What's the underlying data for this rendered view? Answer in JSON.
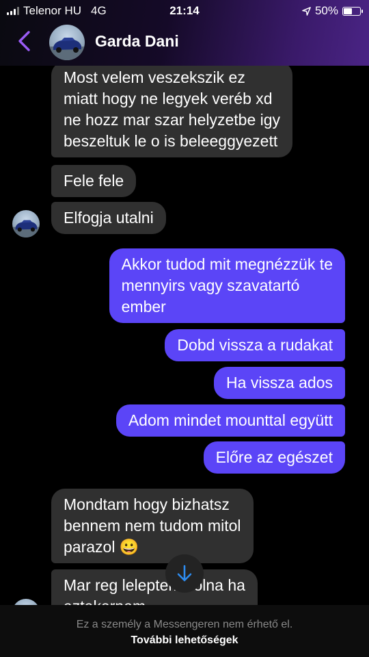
{
  "status_bar": {
    "carrier": "Telenor HU",
    "network": "4G",
    "time": "21:14",
    "battery": "50%",
    "battery_level": 0.5
  },
  "header": {
    "contact_name": "Garda Dani",
    "avatar_icon": "car-photo",
    "accent_color": "#9b5cf6"
  },
  "messages": [
    {
      "side": "in",
      "text": "Most velem veszekszik ez\nmiatt hogy ne legyek veréb xd\nne hozz mar szar helyzetbe igy\nbeszeltuk le o is beleeggyezett"
    },
    {
      "side": "in",
      "text": "Fele fele"
    },
    {
      "side": "in",
      "text": "Elfogja utalni"
    },
    {
      "side": "out",
      "text": "Akkor tudod mit megnézzük te\nmennyirs vagy szavatartó\nember"
    },
    {
      "side": "out",
      "text": "Dobd vissza a rudakat"
    },
    {
      "side": "out",
      "text": "Ha vissza ados"
    },
    {
      "side": "out",
      "text": "Adom mindet mounttal együtt"
    },
    {
      "side": "out",
      "text": "Előre az egészet"
    },
    {
      "side": "in",
      "text": "Mondtam hogy bizhatsz\nbennem nem tudom mitol\nparazol 😀"
    },
    {
      "side": "in",
      "text": "Mar reg leleptem volna ha\naztakarnam"
    }
  ],
  "colors": {
    "incoming_bubble": "#303030",
    "outgoing_bubble": "#5b45f7",
    "scroll_arrow": "#2d8cf0"
  },
  "footer": {
    "note": "Ez a személy a Messengeren nem érhető el.",
    "link": "További lehetőségek"
  }
}
